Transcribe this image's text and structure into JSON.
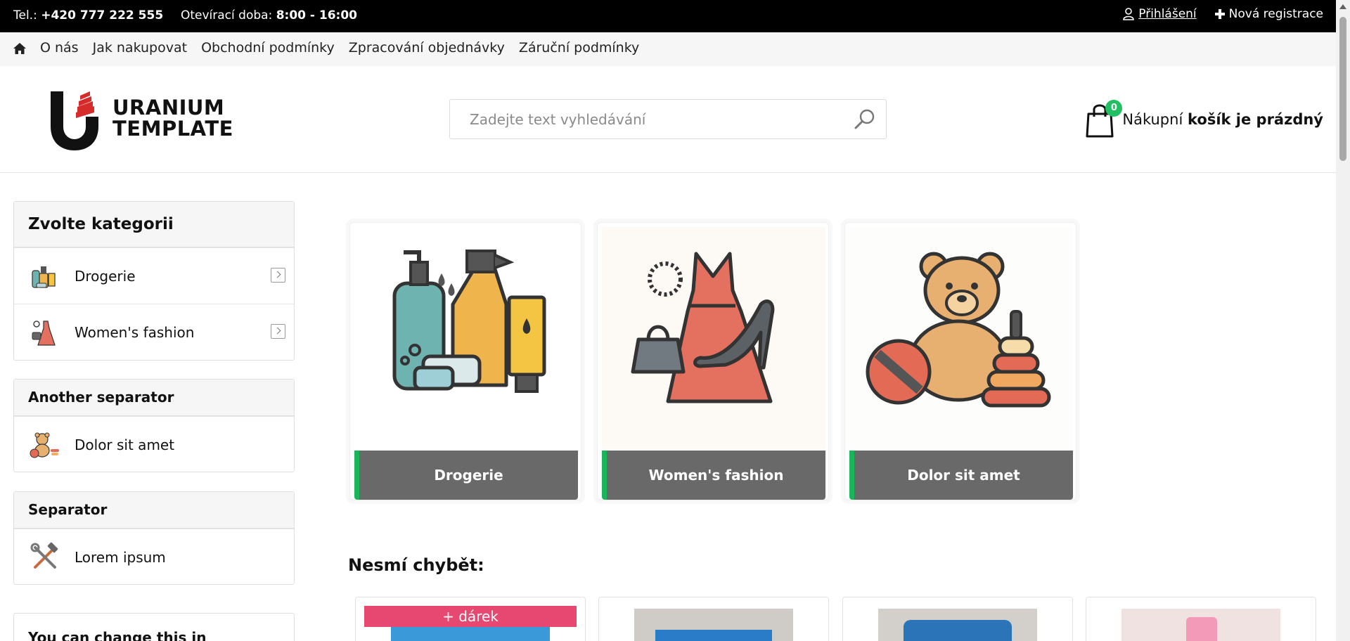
{
  "topbar": {
    "phone_label": "Tel.:",
    "phone": "+420 777 222 555",
    "hours_label": "Otevírací doba:",
    "hours": "8:00 - 16:00",
    "login": "Přihlášení",
    "register": "Nová registrace"
  },
  "nav": {
    "items": [
      "O nás",
      "Jak nakupovat",
      "Obchodní podmínky",
      "Zpracování objednávky",
      "Záruční podmínky"
    ]
  },
  "header": {
    "logo_line1": "URANIUM",
    "logo_line2": "TEMPLATE",
    "search_placeholder": "Zadejte text vyhledávání",
    "cart_count": "0",
    "cart_text_normal": "Nákupní",
    "cart_text_bold": "košík je prázdný"
  },
  "sidebar": {
    "category_title": "Zvolte kategorii",
    "categories": [
      {
        "label": "Drogerie",
        "icon": "cleaning-products-icon"
      },
      {
        "label": "Women's fashion",
        "icon": "dress-icon"
      }
    ],
    "another_separator": {
      "title": "Another separator",
      "item": "Dolor sit amet"
    },
    "separator": {
      "title": "Separator",
      "item": "Lorem ipsum"
    },
    "info_title": "You can change this in"
  },
  "tiles": [
    {
      "label": "Drogerie",
      "icon": "cleaning-products-icon"
    },
    {
      "label": "Women's fashion",
      "icon": "dress-icon"
    },
    {
      "label": "Dolor sit amet",
      "icon": "teddy-bear-icon"
    }
  ],
  "featured": {
    "title": "Nesmí chybět:",
    "gift_badge": "+ dárek"
  },
  "colors": {
    "accent_green": "#19b55a",
    "gift_pink": "#e64872",
    "tile_label_bg": "#696969",
    "logo_red": "#d62b2b"
  }
}
